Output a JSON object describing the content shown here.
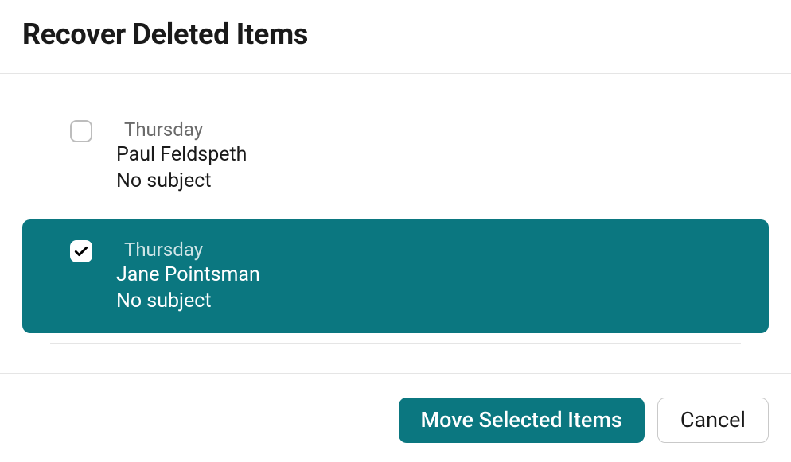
{
  "dialog": {
    "title": "Recover Deleted Items"
  },
  "items": [
    {
      "date": "Thursday",
      "sender": "Paul Feldspeth",
      "subject": "No subject",
      "selected": false
    },
    {
      "date": "Thursday",
      "sender": "Jane Pointsman",
      "subject": "No subject",
      "selected": true
    }
  ],
  "footer": {
    "move_label": "Move Selected Items",
    "cancel_label": "Cancel"
  }
}
